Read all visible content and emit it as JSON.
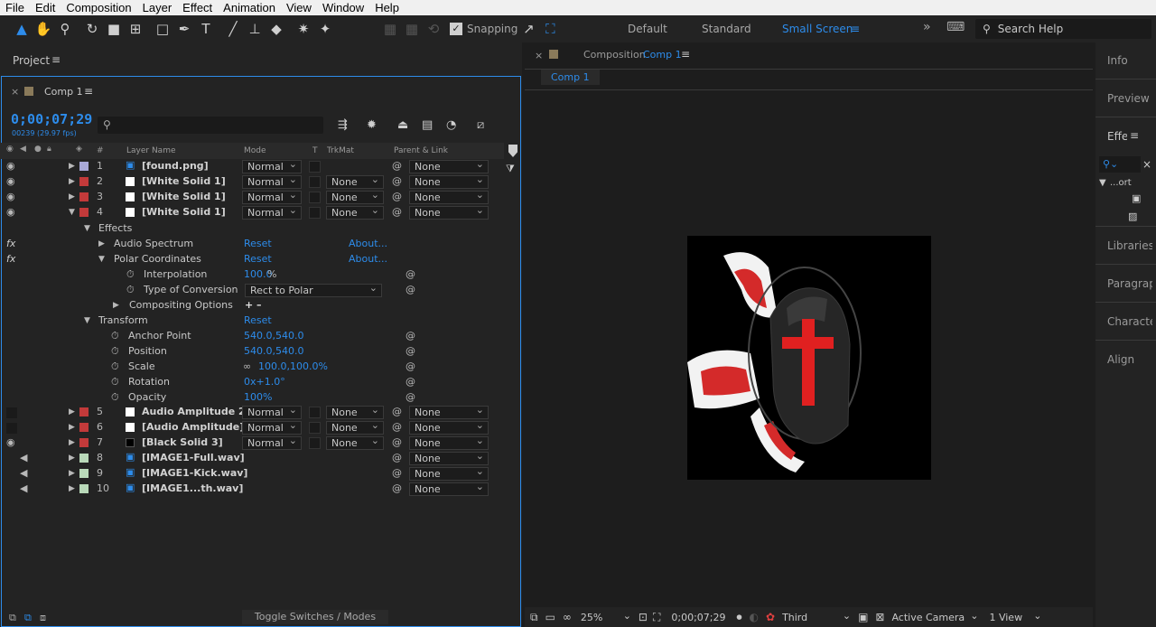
{
  "menu": [
    "File",
    "Edit",
    "Composition",
    "Layer",
    "Effect",
    "Animation",
    "View",
    "Window",
    "Help"
  ],
  "toolbar": {
    "snapping_label": "Snapping",
    "workspaces": [
      "Default",
      "Standard",
      "Small Screen"
    ],
    "search_placeholder": "Search Help"
  },
  "project_panel": {
    "title": "Project"
  },
  "timeline": {
    "tab_label": "Comp 1",
    "timecode": "0;00;07;29",
    "frame_info": "00239 (29.97 fps)",
    "columns": {
      "num": "#",
      "layer_name": "Layer Name",
      "mode": "Mode",
      "t": "T",
      "trkmat": "TrkMat",
      "parent": "Parent & Link"
    },
    "layers": [
      {
        "num": "1",
        "name": "[found.png]",
        "mode": "Normal",
        "trkmat": "",
        "parent": "None",
        "color": "#a9a9d8",
        "swatch": "#ffffff"
      },
      {
        "num": "2",
        "name": "[White Solid 1]",
        "mode": "Normal",
        "trkmat": "None",
        "parent": "None",
        "color": "#c23a3a",
        "swatch": "#ffffff"
      },
      {
        "num": "3",
        "name": "[White Solid 1]",
        "mode": "Normal",
        "trkmat": "None",
        "parent": "None",
        "color": "#c23a3a",
        "swatch": "#ffffff"
      },
      {
        "num": "4",
        "name": "[White Solid 1]",
        "mode": "Normal",
        "trkmat": "None",
        "parent": "None",
        "color": "#c23a3a",
        "swatch": "#ffffff"
      }
    ],
    "effects_label": "Effects",
    "effects": [
      {
        "name": "Audio Spectrum",
        "reset": "Reset",
        "about": "About..."
      },
      {
        "name": "Polar Coordinates",
        "reset": "Reset",
        "about": "About..."
      }
    ],
    "polar_props": {
      "interpolation_label": "Interpolation",
      "interpolation_value": "100.0",
      "interpolation_unit": "%",
      "conversion_label": "Type of Conversion",
      "conversion_value": "Rect to Polar",
      "compositing_label": "Compositing Options",
      "compositing_value": "+ –"
    },
    "transform": {
      "label": "Transform",
      "reset": "Reset",
      "props": [
        {
          "name": "Anchor Point",
          "value": "540.0,540.0"
        },
        {
          "name": "Position",
          "value": "540.0,540.0"
        },
        {
          "name": "Scale",
          "value": "100.0,100.0%"
        },
        {
          "name": "Rotation",
          "value": "0x+1.0°"
        },
        {
          "name": "Opacity",
          "value": "100%"
        }
      ]
    },
    "layers2": [
      {
        "num": "5",
        "name": "Audio Amplitude 2",
        "mode": "Normal",
        "trkmat": "None",
        "parent": "None",
        "color": "#c23a3a",
        "swatch": "#ffffff"
      },
      {
        "num": "6",
        "name": "[Audio Amplitude]",
        "mode": "Normal",
        "trkmat": "None",
        "parent": "None",
        "color": "#c23a3a",
        "swatch": "#ffffff"
      },
      {
        "num": "7",
        "name": "[Black Solid 3]",
        "mode": "Normal",
        "trkmat": "None",
        "parent": "None",
        "color": "#c23a3a",
        "swatch": "#000000"
      },
      {
        "num": "8",
        "name": "[IMAGE1-Full.wav]",
        "parent": "None",
        "color": "#b9d9b9"
      },
      {
        "num": "9",
        "name": "[IMAGE1-Kick.wav]",
        "parent": "None",
        "color": "#b9d9b9"
      },
      {
        "num": "10",
        "name": "[IMAGE1...th.wav]",
        "parent": "None",
        "color": "#b9d9b9"
      }
    ],
    "toggle_label": "Toggle Switches / Modes"
  },
  "composition": {
    "title_prefix": "Composition",
    "title_name": "Comp 1",
    "tab": "Comp 1"
  },
  "viewer_footer": {
    "zoom": "25%",
    "timecode": "0;00;07;29",
    "resolution": "Third",
    "camera": "Active Camera",
    "views": "1 View"
  },
  "side_panels": [
    "Info",
    "Preview",
    "Effe",
    "Libraries",
    "Paragraph",
    "Character",
    "Align"
  ],
  "side_tree_label": "...ort"
}
